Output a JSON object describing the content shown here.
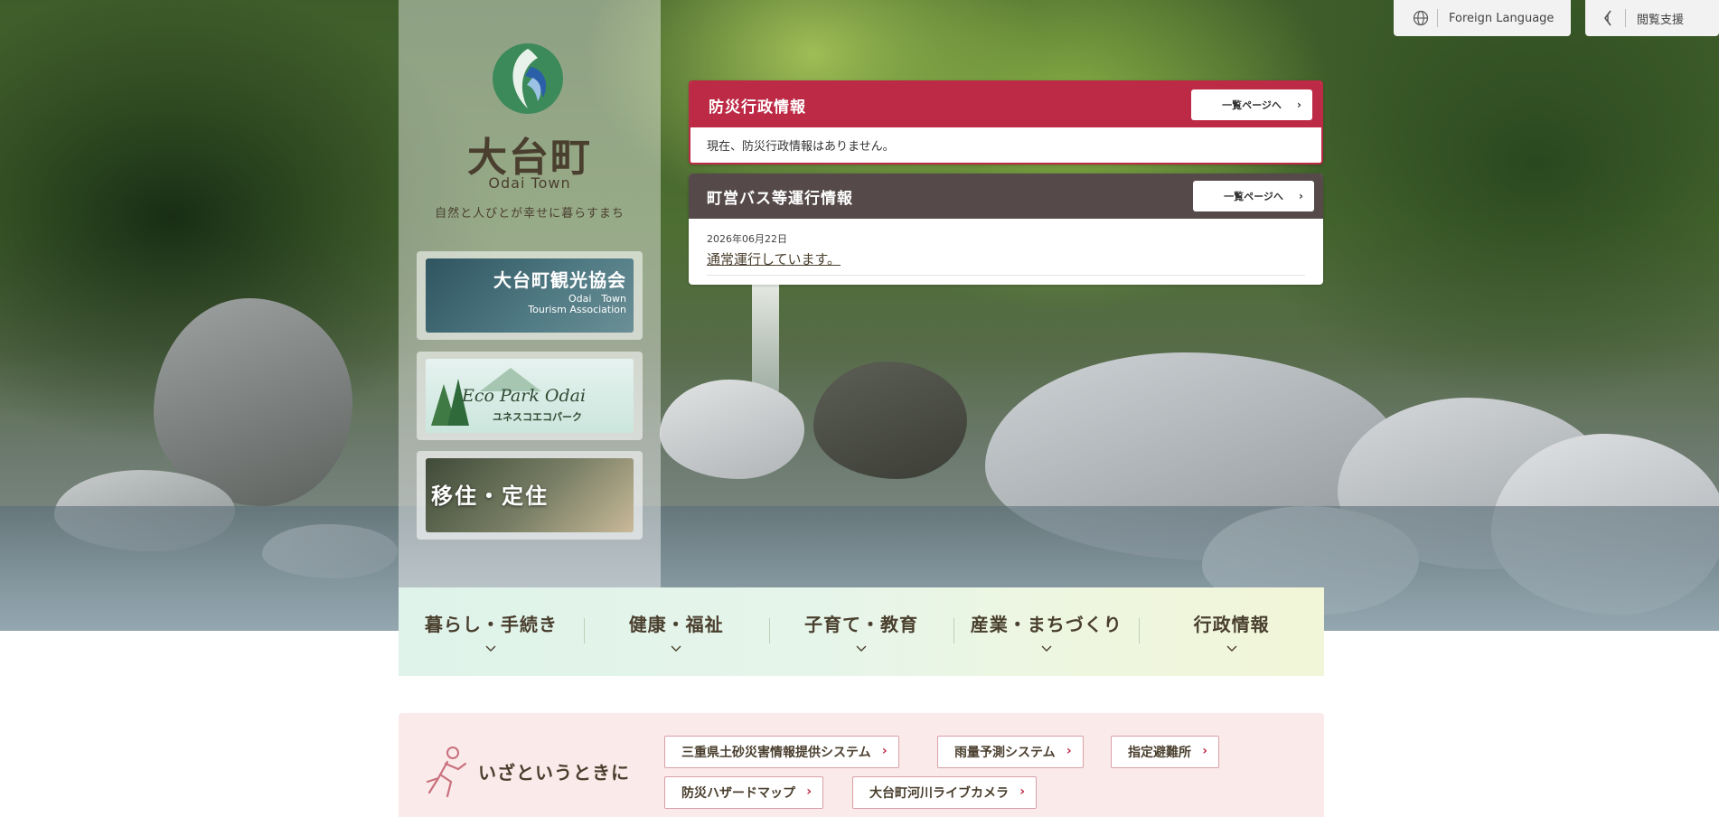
{
  "utility": {
    "language_label": "Foreign Language",
    "accessibility_label": "閲覧支援"
  },
  "brand": {
    "name": "大台町",
    "roman": "Odai Town",
    "tagline": "自然と人びとが幸せに暮らすまち",
    "colors": {
      "logo_green": "#3c8a5a",
      "logo_blue": "#2b5fa8",
      "text_brown": "#4a3f2e"
    }
  },
  "banners": [
    {
      "title": "大台町観光協会",
      "sub1": "Odai　Town",
      "sub2": "Tourism Association"
    },
    {
      "title": "Eco Park Odai",
      "sub": "ユネスコエコパーク"
    },
    {
      "title": "移住・定住"
    }
  ],
  "disaster_panel": {
    "title": "防災行政情報",
    "more_label": "一覧ページへ",
    "message": "現在、防災行政情報はありません。",
    "color": "#bd2a45"
  },
  "bus_panel": {
    "title": "町営バス等運行情報",
    "more_label": "一覧ページへ",
    "date": "2026年06月22日",
    "status": "通常運行しています。",
    "color": "#554949"
  },
  "nav": {
    "items": [
      {
        "label": "暮らし・手続き"
      },
      {
        "label": "健康・福祉"
      },
      {
        "label": "子育て・教育"
      },
      {
        "label": "産業・まちづくり"
      },
      {
        "label": "行政情報"
      }
    ]
  },
  "emergency": {
    "title": "いざというときに",
    "links": [
      {
        "label": "三重県土砂災害情報提供システム"
      },
      {
        "label": "雨量予測システム"
      },
      {
        "label": "指定避難所"
      },
      {
        "label": "防災ハザードマップ"
      },
      {
        "label": "大台町河川ライブカメラ"
      }
    ]
  }
}
